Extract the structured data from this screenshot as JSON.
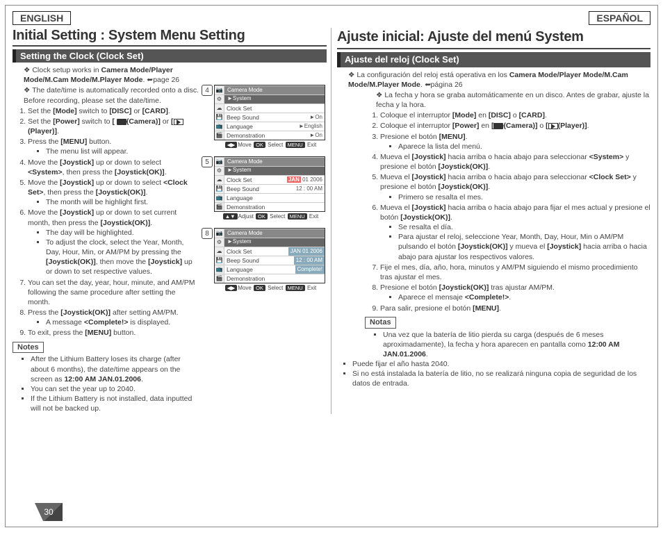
{
  "lang": {
    "en": "ENGLISH",
    "es": "ESPAÑOL"
  },
  "en": {
    "h1": "Initial Setting : System Menu Setting",
    "sect": "Setting the Clock (Clock Set)",
    "intro1a": "Clock setup works in ",
    "intro1b": "Camera Mode/Player Mode/M.Cam Mode/M.Player Mode",
    "intro1c": ". ",
    "intro1d": "page 26",
    "intro2": "The date/time is automatically recorded onto a disc. Before recording, please set the date/time.",
    "s1a": "Set the ",
    "s1b": "[Mode]",
    "s1c": " switch to ",
    "s1d": "[DISC]",
    "s1e": " or ",
    "s1f": "[CARD]",
    "s1g": ".",
    "s2a": "Set the ",
    "s2b": "[Power]",
    "s2c": " switch to ",
    "s2d": "[",
    "s2e": "(Camera)]",
    "s2f": " or ",
    "s2g": "[",
    "s2h": "(Player)]",
    "s2i": ".",
    "s3a": "Press the ",
    "s3b": "[MENU]",
    "s3c": " button.",
    "s3n": "The menu list will appear.",
    "s4a": "Move the ",
    "s4b": "[Joystick]",
    "s4c": " up or down to select ",
    "s4d": "<System>",
    "s4e": ", then press the ",
    "s4f": "[Joystick(OK)]",
    "s4g": ".",
    "s5a": "Move the ",
    "s5b": "[Joystick]",
    "s5c": " up or down to select ",
    "s5d": "<Clock Set>",
    "s5e": ", then press the ",
    "s5f": "[Joystick(OK)]",
    "s5g": ".",
    "s5n": "The month will be highlight first.",
    "s6a": "Move the ",
    "s6b": "[Joystick]",
    "s6c": " up or down to set current month, then press the ",
    "s6d": "[Joystick(OK)]",
    "s6e": ".",
    "s6n1": "The day will be highlighted.",
    "s6n2a": "To adjust the clock, select the Year, Month, Day, Hour, Min, or AM/PM by pressing the ",
    "s6n2b": "[Joystick(OK)]",
    "s6n2c": ", then move the ",
    "s6n2d": "[Joystick]",
    "s6n2e": " up or down to set respective values.",
    "s7": "You can set the day, year, hour, minute, and AM/PM following the same procedure after setting the month.",
    "s8a": "Press the ",
    "s8b": "[Joystick(OK)]",
    "s8c": " after setting AM/PM.",
    "s8n1a": "A message ",
    "s8n1b": "<Complete!>",
    "s8n1c": " is displayed.",
    "s9a": "To exit, press the ",
    "s9b": "[MENU]",
    "s9c": " button.",
    "notes": "Notes",
    "n1a": "After the Lithium Battery loses its charge (after about 6 months), the date/time appears on the screen as ",
    "n1b": "12:00 AM JAN.01.2006",
    "n1c": ".",
    "n2": "You can set the year up to 2040.",
    "n3": "If the Lithium Battery is not installed, data inputted will not be backed up."
  },
  "es": {
    "h1": "Ajuste inicial: Ajuste del menú System",
    "sect": "Ajuste del reloj (Clock Set)",
    "intro1a": "La configuración del reloj está operativa en los ",
    "intro1b": "Camera Mode/Player Mode/M.Cam Mode/M.Player Mode",
    "intro1c": ". ",
    "intro1d": "página 26",
    "intro2": "La fecha y hora se graba automáticamente en un disco. Antes de grabar, ajuste la fecha y la hora.",
    "s1a": "Coloque el interruptor ",
    "s1b": "[Mode]",
    "s1c": " en ",
    "s1d": "[DISC]",
    "s1e": " o ",
    "s1f": "[CARD]",
    "s1g": ".",
    "s2a": "Coloque el interruptor ",
    "s2b": "[Power]",
    "s2c": " en ",
    "s2d": "[",
    "s2e": "(Camera)]",
    "s2f": " o ",
    "s2g": "[",
    "s2h": "(Player)]",
    "s2i": ".",
    "s3a": "Presione el botón ",
    "s3b": "[MENU]",
    "s3c": ".",
    "s3n": "Aparece la lista del menú.",
    "s4a": "Mueva el ",
    "s4b": "[Joystick]",
    "s4c": " hacia arriba o hacia abajo para seleccionar ",
    "s4d": "<System>",
    "s4e": " y presione el botón ",
    "s4f": "[Joystick(OK)]",
    "s4g": ".",
    "s5a": "Mueva el ",
    "s5b": "[Joystick]",
    "s5c": " hacia arriba o hacia abajo para seleccionar ",
    "s5d": "<Clock Set>",
    "s5e": " y presione el botón ",
    "s5f": "[Joystick(OK)]",
    "s5g": ".",
    "s5n": "Primero se resalta el mes.",
    "s6a": "Mueva el ",
    "s6b": "[Joystick]",
    "s6c": " hacia arriba o hacia abajo para fijar el mes actual y presione el botón ",
    "s6d": "[Joystick(OK)]",
    "s6e": ".",
    "s6n1": "Se resalta el día.",
    "s6n2a": "Para ajustar el reloj, seleccione Year, Month, Day, Hour, Min o AM/PM pulsando el botón ",
    "s6n2b": "[Joystick(OK)]",
    "s6n2c": " y mueva el ",
    "s6n2d": "[Joystick]",
    "s6n2e": " hacia arriba o hacia abajo para ajustar los respectivos valores.",
    "s7": "Fije el mes, día, año, hora, minutos y AM/PM siguiendo el mismo procedimiento tras ajustar el mes.",
    "s8a": "Presione el botón ",
    "s8b": "[Joystick(OK)]",
    "s8c": " tras ajustar AM/PM.",
    "s8n1a": "Aparece el mensaje ",
    "s8n1b": "<Complete!>",
    "s8n1c": ".",
    "s9a": "Para salir, presione el botón ",
    "s9b": "[MENU]",
    "s9c": ".",
    "notes": "Notas",
    "n1a": "Una vez que la batería de litio pierda su carga (después de 6 meses aproximadamente), la fecha y hora aparecen en pantalla como ",
    "n1b": "12:00 AM JAN.01.2006",
    "n1c": ".",
    "n2": "Puede fijar el año hasta 2040.",
    "n3": "Si no está instalada la batería de litio, no se realizará ninguna copia de seguridad de los datos de entrada."
  },
  "lcd": {
    "title": "Camera Mode",
    "sys": "►System",
    "items": [
      "Clock Set",
      "Beep Sound",
      "Language",
      "Demonstration"
    ],
    "vals4": [
      "",
      "►On",
      "►English",
      "►On"
    ],
    "date5_m": "JAN",
    "date5_rest": "  01  2006",
    "time5": "12  :  00   AM",
    "date8": "JAN  01  2006",
    "time8": "12  :  00   AM",
    "complete": "Complete!",
    "foot_move": "Move",
    "foot_adjust": "Adjust",
    "foot_ok": "OK",
    "foot_select": "Select",
    "foot_menu": "MENU",
    "foot_exit": "Exit",
    "n4": "4",
    "n5": "5",
    "n8": "8"
  },
  "pagenum": "30"
}
